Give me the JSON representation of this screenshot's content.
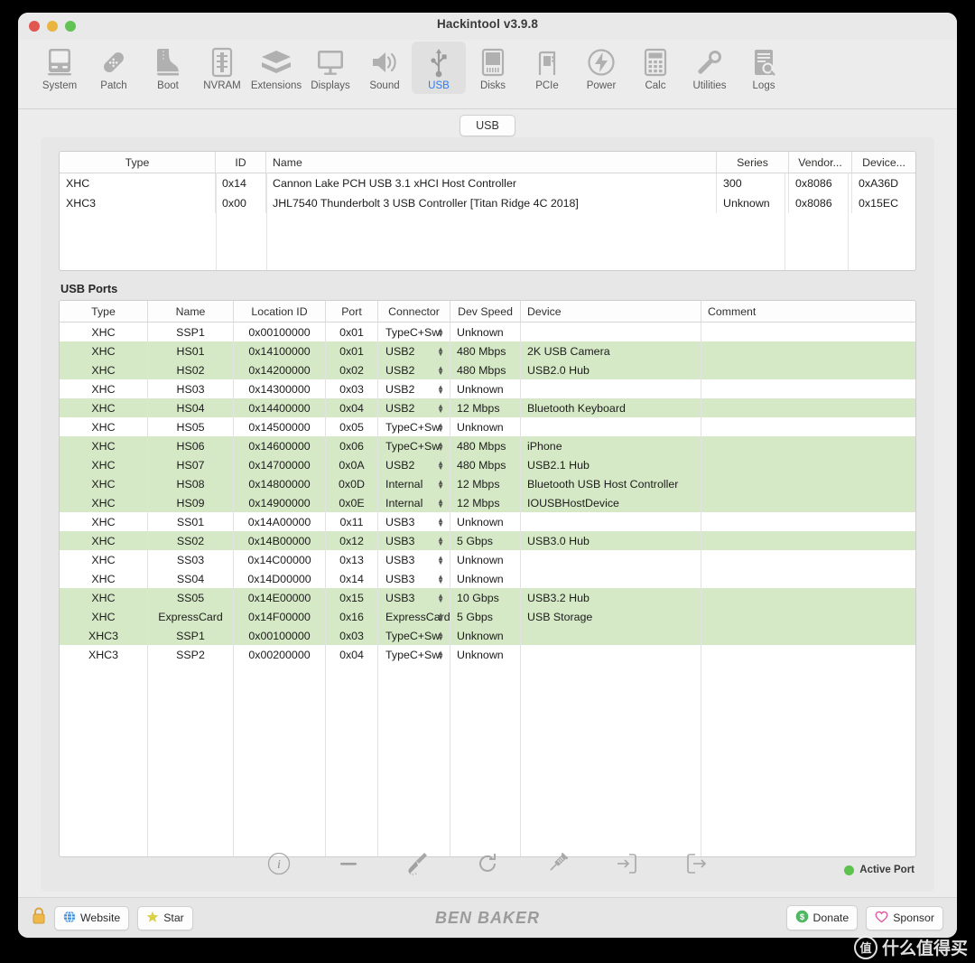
{
  "window": {
    "title": "Hackintool v3.9.8"
  },
  "toolbar": {
    "items": [
      {
        "label": "System",
        "icon": "system-icon",
        "active": false
      },
      {
        "label": "Patch",
        "icon": "patch-icon",
        "active": false
      },
      {
        "label": "Boot",
        "icon": "boot-icon",
        "active": false
      },
      {
        "label": "NVRAM",
        "icon": "nvram-icon",
        "active": false
      },
      {
        "label": "Extensions",
        "icon": "extensions-icon",
        "active": false
      },
      {
        "label": "Displays",
        "icon": "displays-icon",
        "active": false
      },
      {
        "label": "Sound",
        "icon": "sound-icon",
        "active": false
      },
      {
        "label": "USB",
        "icon": "usb-icon",
        "active": true
      },
      {
        "label": "Disks",
        "icon": "disks-icon",
        "active": false
      },
      {
        "label": "PCIe",
        "icon": "pcie-icon",
        "active": false
      },
      {
        "label": "Power",
        "icon": "power-icon",
        "active": false
      },
      {
        "label": "Calc",
        "icon": "calc-icon",
        "active": false
      },
      {
        "label": "Utilities",
        "icon": "utilities-icon",
        "active": false
      },
      {
        "label": "Logs",
        "icon": "logs-icon",
        "active": false
      }
    ]
  },
  "tab": {
    "label": "USB"
  },
  "controllers": {
    "columns": [
      "Type",
      "ID",
      "Name",
      "Series",
      "Vendor...",
      "Device..."
    ],
    "rows": [
      {
        "type": "XHC",
        "id": "0x14",
        "name": "Cannon Lake PCH USB 3.1 xHCI Host Controller",
        "series": "300",
        "vendor": "0x8086",
        "device": "0xA36D"
      },
      {
        "type": "XHC3",
        "id": "0x00",
        "name": "JHL7540 Thunderbolt 3 USB Controller [Titan Ridge 4C 2018]",
        "series": "Unknown",
        "vendor": "0x8086",
        "device": "0x15EC"
      }
    ]
  },
  "ports": {
    "title": "USB Ports",
    "columns": [
      "Type",
      "Name",
      "Location ID",
      "Port",
      "Connector",
      "Dev Speed",
      "Device",
      "Comment"
    ],
    "rows": [
      {
        "type": "XHC",
        "name": "SSP1",
        "location": "0x00100000",
        "port": "0x01",
        "connector": "TypeC+Sw",
        "speed": "Unknown",
        "device": "",
        "comment": "",
        "active": false
      },
      {
        "type": "XHC",
        "name": "HS01",
        "location": "0x14100000",
        "port": "0x01",
        "connector": "USB2",
        "speed": "480 Mbps",
        "device": "2K USB Camera",
        "comment": "",
        "active": true
      },
      {
        "type": "XHC",
        "name": "HS02",
        "location": "0x14200000",
        "port": "0x02",
        "connector": "USB2",
        "speed": "480 Mbps",
        "device": "USB2.0 Hub",
        "comment": "",
        "active": true
      },
      {
        "type": "XHC",
        "name": "HS03",
        "location": "0x14300000",
        "port": "0x03",
        "connector": "USB2",
        "speed": "Unknown",
        "device": "",
        "comment": "",
        "active": false
      },
      {
        "type": "XHC",
        "name": "HS04",
        "location": "0x14400000",
        "port": "0x04",
        "connector": "USB2",
        "speed": "12 Mbps",
        "device": "Bluetooth Keyboard",
        "comment": "",
        "active": true
      },
      {
        "type": "XHC",
        "name": "HS05",
        "location": "0x14500000",
        "port": "0x05",
        "connector": "TypeC+Sw",
        "speed": "Unknown",
        "device": "",
        "comment": "",
        "active": false
      },
      {
        "type": "XHC",
        "name": "HS06",
        "location": "0x14600000",
        "port": "0x06",
        "connector": "TypeC+Sw",
        "speed": "480 Mbps",
        "device": "iPhone",
        "comment": "",
        "active": true
      },
      {
        "type": "XHC",
        "name": "HS07",
        "location": "0x14700000",
        "port": "0x0A",
        "connector": "USB2",
        "speed": "480 Mbps",
        "device": "USB2.1 Hub",
        "comment": "",
        "active": true
      },
      {
        "type": "XHC",
        "name": "HS08",
        "location": "0x14800000",
        "port": "0x0D",
        "connector": "Internal",
        "speed": "12 Mbps",
        "device": "Bluetooth USB Host Controller",
        "comment": "",
        "active": true
      },
      {
        "type": "XHC",
        "name": "HS09",
        "location": "0x14900000",
        "port": "0x0E",
        "connector": "Internal",
        "speed": "12 Mbps",
        "device": "IOUSBHostDevice",
        "comment": "",
        "active": true
      },
      {
        "type": "XHC",
        "name": "SS01",
        "location": "0x14A00000",
        "port": "0x11",
        "connector": "USB3",
        "speed": "Unknown",
        "device": "",
        "comment": "",
        "active": false
      },
      {
        "type": "XHC",
        "name": "SS02",
        "location": "0x14B00000",
        "port": "0x12",
        "connector": "USB3",
        "speed": "5 Gbps",
        "device": "USB3.0 Hub",
        "comment": "",
        "active": true
      },
      {
        "type": "XHC",
        "name": "SS03",
        "location": "0x14C00000",
        "port": "0x13",
        "connector": "USB3",
        "speed": "Unknown",
        "device": "",
        "comment": "",
        "active": false
      },
      {
        "type": "XHC",
        "name": "SS04",
        "location": "0x14D00000",
        "port": "0x14",
        "connector": "USB3",
        "speed": "Unknown",
        "device": "",
        "comment": "",
        "active": false
      },
      {
        "type": "XHC",
        "name": "SS05",
        "location": "0x14E00000",
        "port": "0x15",
        "connector": "USB3",
        "speed": "10 Gbps",
        "device": "USB3.2 Hub",
        "comment": "",
        "active": true
      },
      {
        "type": "XHC",
        "name": "ExpressCard",
        "location": "0x14F00000",
        "port": "0x16",
        "connector": "ExpressCard",
        "speed": "5 Gbps",
        "device": "USB Storage",
        "comment": "",
        "active": true
      },
      {
        "type": "XHC3",
        "name": "SSP1",
        "location": "0x00100000",
        "port": "0x03",
        "connector": "TypeC+Sw",
        "speed": "Unknown",
        "device": "",
        "comment": "",
        "active": true
      },
      {
        "type": "XHC3",
        "name": "SSP2",
        "location": "0x00200000",
        "port": "0x04",
        "connector": "TypeC+Sw",
        "speed": "Unknown",
        "device": "",
        "comment": "",
        "active": false
      }
    ],
    "legend": {
      "label": "Active Port",
      "color": "#5ec24f"
    }
  },
  "actions": [
    {
      "name": "info-icon"
    },
    {
      "name": "minus-icon"
    },
    {
      "name": "broom-icon"
    },
    {
      "name": "refresh-icon"
    },
    {
      "name": "syringe-icon"
    },
    {
      "name": "import-icon"
    },
    {
      "name": "export-icon"
    }
  ],
  "footer": {
    "lock_icon": "lock-icon",
    "website_label": "Website",
    "star_label": "Star",
    "brand": "BEN BAKER",
    "donate_label": "Donate",
    "sponsor_label": "Sponsor",
    "watermark": "什么值得买",
    "watermark_mark": "值"
  }
}
